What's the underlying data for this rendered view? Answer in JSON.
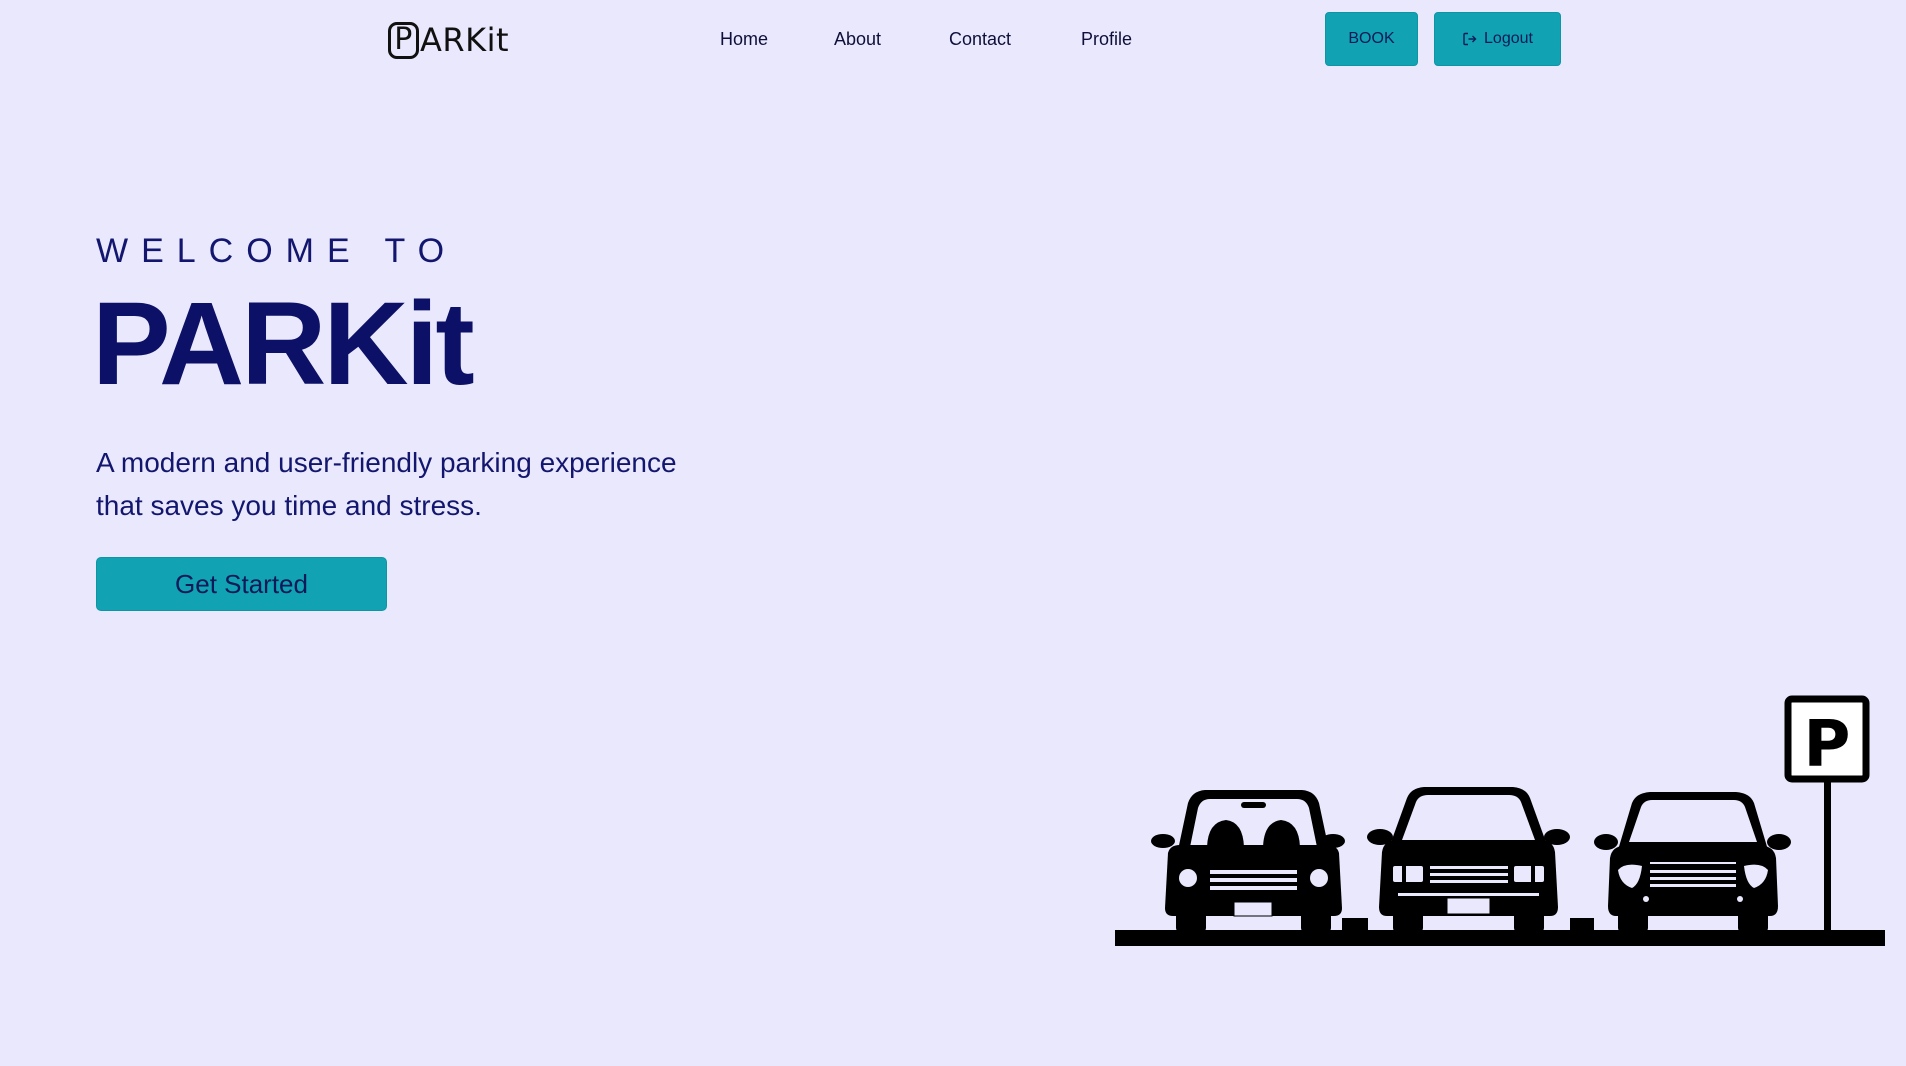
{
  "navbar": {
    "logo_letter": "P",
    "logo_rest": "ARKit",
    "links": {
      "home": "Home",
      "about": "About",
      "contact": "Contact",
      "profile": "Profile"
    },
    "book_label": "BOOK",
    "logout_label": "Logout"
  },
  "hero": {
    "welcome": "WELCOME TO",
    "title": "PARKit",
    "tagline_line1": "A modern and user-friendly parking experience",
    "tagline_line2": "that saves you time and stress.",
    "cta_label": "Get Started"
  },
  "illustration": {
    "sign_letter": "P"
  },
  "colors": {
    "background": "#e9e8fc",
    "accent_button": "#11a3b3",
    "heading_navy": "#0c1066"
  },
  "icons": {
    "logout": "logout-icon",
    "parking_sign": "parking-sign-icon",
    "car": "car-icon"
  }
}
